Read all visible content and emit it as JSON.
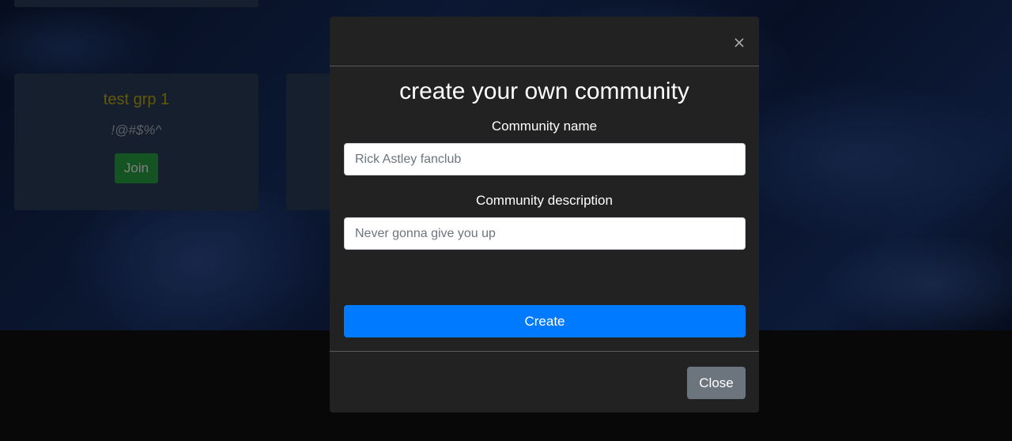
{
  "background": {
    "cards": [
      {
        "title": "test grp 1",
        "description": "!@#$%^",
        "button_label": "Join"
      }
    ]
  },
  "modal": {
    "close_icon": "close-icon",
    "title": "create your own community",
    "name_label": "Community name",
    "name_placeholder": "Rick Astley fanclub",
    "description_label": "Community description",
    "description_placeholder": "Never gonna give you up",
    "create_label": "Create",
    "close_label": "Close"
  },
  "colors": {
    "primary": "#007bff",
    "secondary": "#6c757d",
    "success": "#28a745",
    "card_title": "#c9b10f",
    "modal_bg": "#222222"
  }
}
